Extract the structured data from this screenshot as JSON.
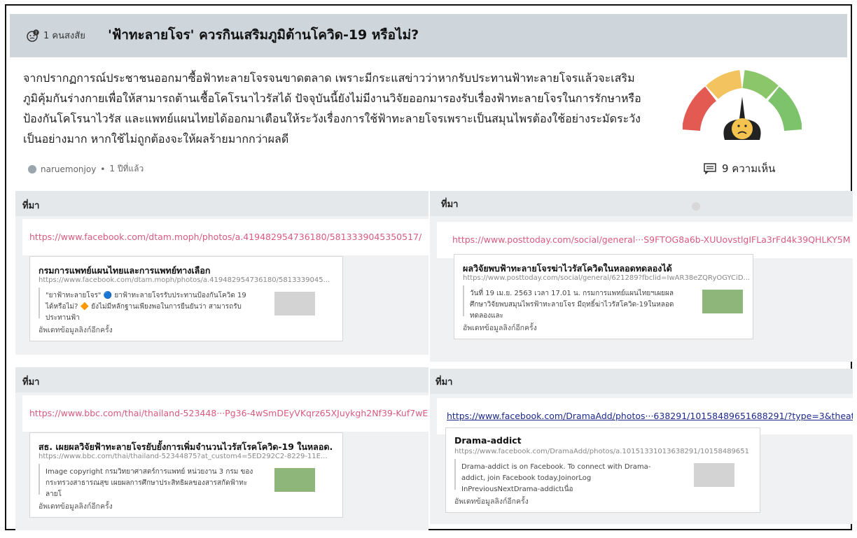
{
  "question": {
    "count_label": "1 คนสงสัย",
    "title": "'ฟ้าทะลายโจร' ควรกินเสริมภูมิต้านโควิด-19 หรือไม่?",
    "description": "จากปรากฏการณ์ประชาชนออกมาซื้อฟ้าทะลายโจรจนขาดตลาด เพราะมีกระแสข่าวว่าหากรับประทานฟ้าทะลายโจรแล้วจะเสริมภูมิคุ้มกันร่างกายเพื่อให้สามารถต้านเชื้อโคโรนาไวรัสได้ ปัจจุบันนี้ยังไม่มีงานวิจัยออกมารองรับเรื่องฟ้าทะลายโจรในการรักษาหรือป้องกันโคโรนาไวรัส และแพทย์แผนไทยได้ออกมาเตือนให้ระวังเรื่องการใช้ฟ้าทะลายโจรเพราะเป็นสมุนไพรต้องใช้อย่างระมัดระวังเป็นอย่างมาก หากใช้ไม่ถูกต้องจะให้ผลร้ายมากกว่าผลดี",
    "author": "naruemonjoy",
    "time_ago": "1 ปีที่แล้ว",
    "comments_label": "9 ความเห็น",
    "gauge": {
      "icon": "sad-face-gauge-icon",
      "colors": [
        "#e35a52",
        "#f2c35f",
        "#8cc66a",
        "#7cc36b"
      ]
    }
  },
  "sources": [
    {
      "label": "ที่มา",
      "url": "https://www.facebook.com/dtam.moph/photos/a.419482954736180/5813339045350517/",
      "card_title": "กรมการแพทย์แผนไทยและการแพทย์ทางเลือก",
      "card_url": "https://www.facebook.com/dtam.moph/photos/a.419482954736180/5813339045...",
      "card_desc": "\"ยาฟ้าทะลายโจร\" 🔵 ยาฟ้าทะลายโจรรับประทานป้องกันโควิด 19 ได้หรือไม่? 🔶 ยังไม่มีหลักฐานเพียงพอในการยืนยันว่า สามารถรับประทานฟ้า",
      "update": "อัพเดทข้อมูลลิงก์อีกครั้ง"
    },
    {
      "label": "ที่มา",
      "url": "https://www.posttoday.com/social/general···S9FTOG8a6b-XUUovstlgIFLa3rFd4k39QHLKY5M",
      "card_title": "ผลวิจัยพบฟ้าทะลายโจรฆ่าไวรัสโควิดในหลอดทดลองได้",
      "card_url": "https://www.posttoday.com/social/general/621289?fbclid=IwAR38eZQRyOGYCiD...",
      "card_desc": "วันที่ 19 เม.ย. 2563 เวลา 17.01 น. กรมการแพทย์แผนไทยฯเผยผลศึกษาวิจัยพบสมุนไพรฟ้าทะลายโจร มีฤทธิ์ฆ่าไวรัสโควิด-19ในหลอดทดลองและ",
      "update": "อัพเดทข้อมูลลิงก์อีกครั้ง"
    },
    {
      "label": "ที่มา",
      "url": "https://www.bbc.com/thai/thailand-523448···Pg36-4wSmDEyVKqrz65XJuykgh2Nf39-Kuf7wE",
      "card_title": "สธ. เผยผลวิจัยฟ้าทะลายโจรยับยั้งการเพิ่มจำนวนไวรัสโรคโควิด-19 ในหลอด...",
      "card_url": "https://www.bbc.com/thai/thailand-52344875?at_custom4=5ED292C2-8229-11E...",
      "card_desc": "Image copyright กรมวิทยาศาสตร์การแพทย์ หน่วยงาน 3 กรม ของกระทรวงสาธารณสุข เผยผลการศึกษาประสิทธิผลของสารสกัดฟ้าทะลายโ",
      "update": "อัพเดทข้อมูลลิงก์อีกครั้ง"
    },
    {
      "label": "ที่มา",
      "url": "https://www.facebook.com/DramaAdd/photos···638291/10158489651688291/?type=3&theat",
      "card_title": "Drama-addict",
      "card_url": "https://www.facebook.com/DramaAdd/photos/a.10151331013638291/10158489651...",
      "card_desc": "Drama-addict is on Facebook. To connect with Drama-addict, join Facebook today.JoinorLog InPreviousNextDrama-addictเนื่อ",
      "update": "อัพเดทข้อมูลลิงก์อีกครั้ง"
    }
  ]
}
